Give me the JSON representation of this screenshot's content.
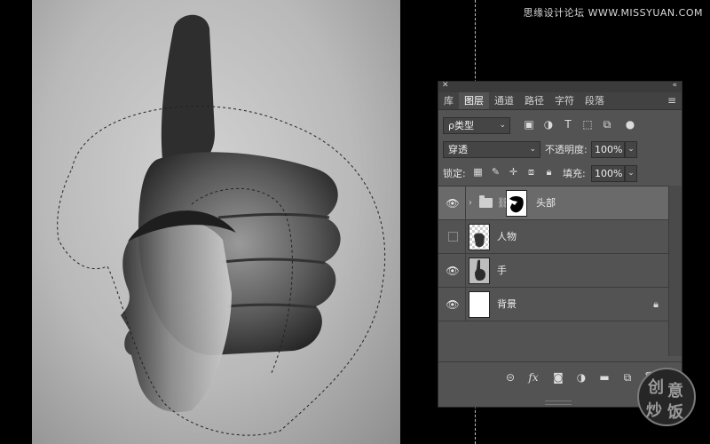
{
  "watermark": "思缘设计论坛 WWW.MISSYUAN.COM",
  "stamp_chars": [
    "创",
    "意",
    "炒",
    "饭"
  ],
  "panel": {
    "collapse_icon": "double-chevron-left",
    "close_icon": "close-x",
    "tabs": [
      {
        "label": "库",
        "active": false
      },
      {
        "label": "图层",
        "active": true
      },
      {
        "label": "通道",
        "active": false
      },
      {
        "label": "路径",
        "active": false
      },
      {
        "label": "字符",
        "active": false
      },
      {
        "label": "段落",
        "active": false
      }
    ],
    "filter": {
      "label": "ρ类型"
    },
    "blend_mode": "穿透",
    "opacity_label": "不透明度:",
    "opacity_value": "100%",
    "lock_label": "锁定:",
    "fill_label": "填充:",
    "fill_value": "100%",
    "layers": [
      {
        "name": "头部",
        "visible": true,
        "selected": true,
        "type": "group",
        "has_mask": true
      },
      {
        "name": "人物",
        "visible": false,
        "selected": false,
        "type": "pixel"
      },
      {
        "name": "手",
        "visible": true,
        "selected": false,
        "type": "pixel"
      },
      {
        "name": "背景",
        "visible": true,
        "selected": false,
        "type": "background",
        "locked": true
      }
    ]
  },
  "colors": {
    "panel_bg": "#535353",
    "selected_row": "#6a6a6a",
    "tab_bar": "#424242",
    "workspace": "#000000"
  }
}
